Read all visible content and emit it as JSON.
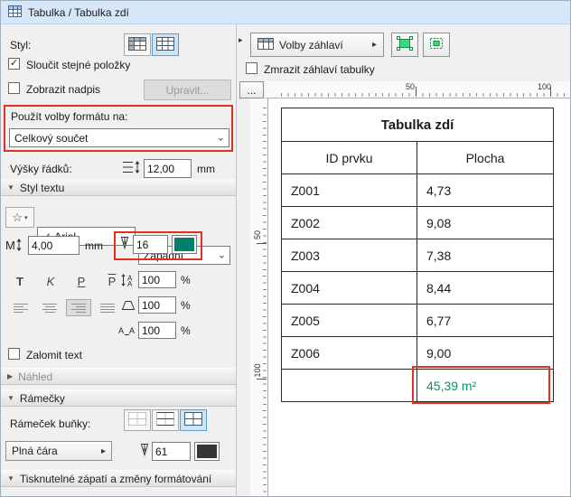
{
  "window": {
    "title": "Tabulka / Tabulka zdí"
  },
  "icons": {
    "check": "✓",
    "combo_arrow": "⌄",
    "popup_arrow": "▸",
    "section_expanded": "▼",
    "section_collapsed": "▶",
    "star": "☆",
    "splitter_arrow": "▸"
  },
  "panel": {
    "style_label": "Styl:",
    "merge_items_label": "Sloučit stejné položky",
    "show_title_label": "Zobrazit nadpis",
    "edit_button": "Upravit...",
    "format_target_label": "Použít volby formátu na:",
    "format_target_value": "Celkový součet",
    "row_heights_label": "Výšky řádků:",
    "row_heights_value": "12,00",
    "mm_unit": "mm",
    "text_style_title": "Styl textu",
    "font_value": "Arial",
    "script_value": "Západní",
    "text_size_value": "4,00",
    "pen_number": "16",
    "line_spacing_value": "100",
    "char_width_value": "100",
    "char_spacing_value": "100",
    "percent_unit": "%",
    "bold_label": "T",
    "italic_label": "K",
    "underline_label": "P",
    "strike_label": "P",
    "wrap_text_label": "Zalomit text",
    "preview_title": "Náhled",
    "borders_title": "Rámečky",
    "cell_border_label": "Rámeček buňky:",
    "line_type_value": "Plná čára",
    "border_pen_number": "61",
    "footer_title": "Tisknutelné zápatí a změny formátování"
  },
  "toolbar": {
    "header_options_label": "Volby záhlaví",
    "freeze_header_label": "Zmrazit záhlaví tabulky",
    "ruler_corner_label": "..."
  },
  "rulers": {
    "h_50": "50",
    "h_100": "100",
    "v_50": "50",
    "v_100": "100"
  },
  "table": {
    "title": "Tabulka zdí",
    "columns": [
      "ID prvku",
      "Plocha"
    ],
    "rows": [
      {
        "id": "Z001",
        "area": "4,73"
      },
      {
        "id": "Z002",
        "area": "9,08"
      },
      {
        "id": "Z003",
        "area": "7,38"
      },
      {
        "id": "Z004",
        "area": "8,44"
      },
      {
        "id": "Z005",
        "area": "6,77"
      },
      {
        "id": "Z006",
        "area": "9,00"
      }
    ],
    "total": "45,39 m²"
  },
  "colors": {
    "annotation_red": "#e03127",
    "selected_blue_bg": "#cce4f7",
    "total_green": "#00966e",
    "pen_swatch": "#00806b",
    "border_pen_swatch": "#353535",
    "toolbar_icon_green": "#3fd87c"
  }
}
